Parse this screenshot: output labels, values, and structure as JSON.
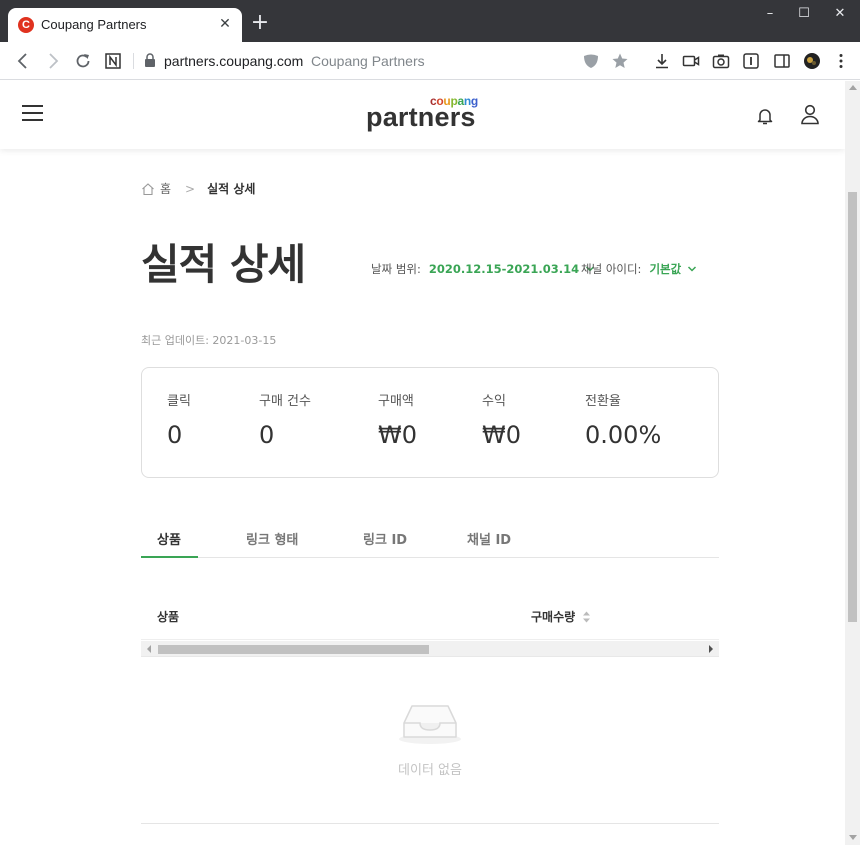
{
  "browser": {
    "tab_title": "Coupang Partners",
    "favicon_letter": "C",
    "url_host": "partners.coupang.com",
    "url_title": "Coupang Partners"
  },
  "header": {
    "logo_top": "coupang",
    "logo_main": "partners",
    "logo_letters": [
      {
        "ch": "c",
        "color": "#a8302f"
      },
      {
        "ch": "o",
        "color": "#d3452a"
      },
      {
        "ch": "u",
        "color": "#e89a1f"
      },
      {
        "ch": "p",
        "color": "#85b82f"
      },
      {
        "ch": "a",
        "color": "#3aa555"
      },
      {
        "ch": "n",
        "color": "#2f8ad5"
      },
      {
        "ch": "g",
        "color": "#3b5fcc"
      }
    ]
  },
  "breadcrumb": {
    "home": "홈",
    "current": "실적 상세"
  },
  "page": {
    "title": "실적 상세",
    "date_range_label": "날짜 범위:",
    "date_range_value": "2020.12.15-2021.03.14",
    "channel_label": "채널 아이디:",
    "channel_value": "기본값",
    "update_text": "최근 업데이트: 2021-03-15"
  },
  "stats": [
    {
      "label": "클릭",
      "value": "0"
    },
    {
      "label": "구매 건수",
      "value": "0"
    },
    {
      "label": "구매액",
      "value": "₩0"
    },
    {
      "label": "수익",
      "value": "₩0"
    },
    {
      "label": "전환율",
      "value": "0.00%"
    }
  ],
  "tabs": [
    {
      "label": "상품",
      "active": true
    },
    {
      "label": "링크 형태",
      "active": false
    },
    {
      "label": "링크 ID",
      "active": false
    },
    {
      "label": "채널 ID",
      "active": false
    }
  ],
  "table": {
    "columns": [
      "상품",
      "구매수량"
    ],
    "empty_text": "데이터 없음"
  },
  "colors": {
    "accent_green": "#3aa555",
    "favicon_red": "#e0321f"
  }
}
